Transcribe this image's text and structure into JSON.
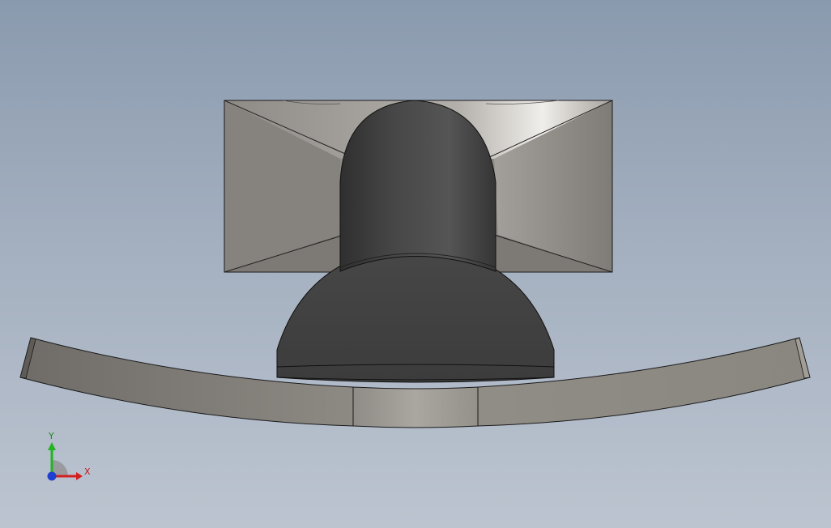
{
  "viewport": {
    "background_top": "#8a9aae",
    "background_bottom": "#bcc4d0"
  },
  "model": {
    "dark_body_color": "#434343",
    "housing_color": "#8e8a85",
    "arm_color": "#8a8680"
  },
  "triad": {
    "x_label": "X",
    "y_label": "Y",
    "x_color": "#d42020",
    "y_color": "#22b422",
    "z_color": "#1f3fd0"
  }
}
